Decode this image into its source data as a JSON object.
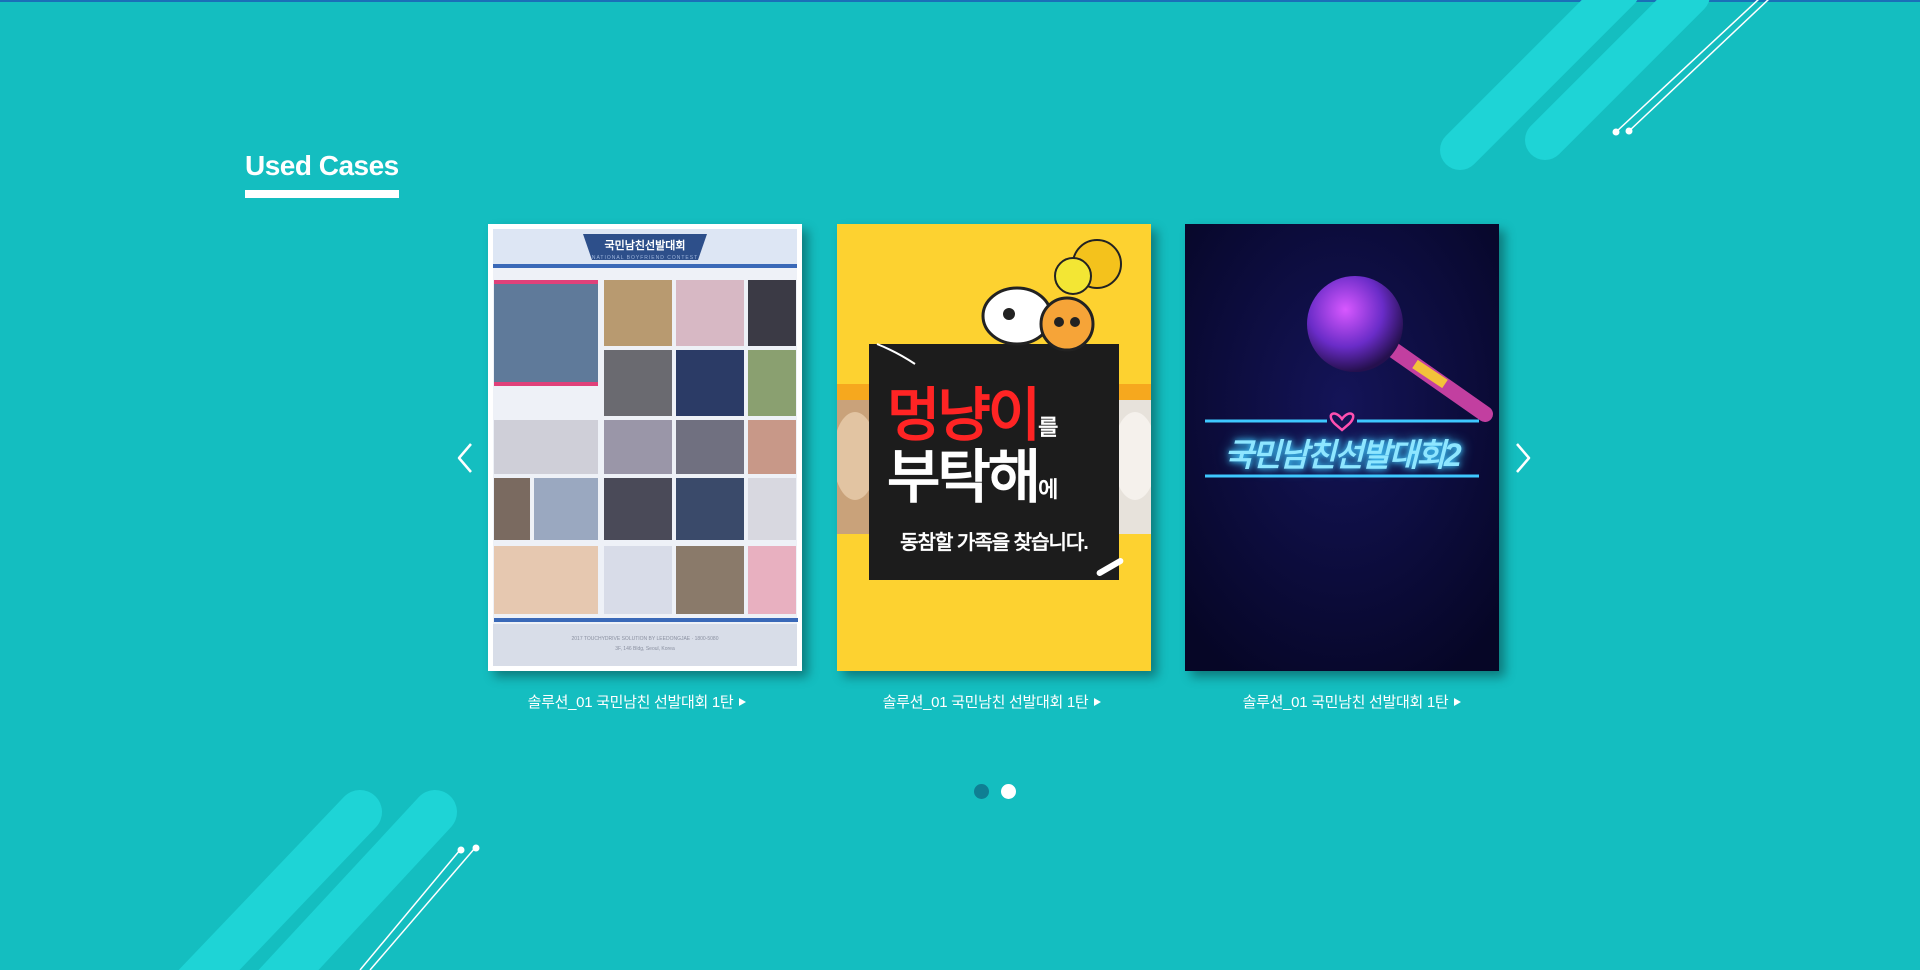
{
  "section": {
    "title": "Used Cases"
  },
  "nav": {
    "prev_icon": "chevron-left-icon",
    "next_icon": "chevron-right-icon"
  },
  "cards": [
    {
      "caption": "솔루션_01  국민남친 선발대회 1탄",
      "poster": {
        "header": "국민남친선발대회",
        "subheader": "NATIONAL BOYFRIEND CONTEST",
        "footer_line1": "2017 TOUCHYDRIVE SOLUTION BY LEEDONGJAE · 1800-5080",
        "footer_line2": "3F, 146 Bldg, Seoul, Korea"
      }
    },
    {
      "caption": "솔루션_01  국민남친 선발대회 1탄",
      "poster": {
        "line1": "멍냥이",
        "line1_suffix": "를",
        "line2": "부탁해",
        "line2_suffix": "에",
        "line3": "동참할 가족을 찾습니다."
      }
    },
    {
      "caption": "솔루션_01  국민남친 선발대회 1탄",
      "poster": {
        "neon_title": "국민남친선발대회2"
      }
    }
  ],
  "pagination": {
    "count": 2,
    "active_index": 1
  },
  "colors": {
    "background": "#14bec0",
    "deco_stripe": "#1ed4d6",
    "dot_inactive": "#0f7f93",
    "dot_active": "#ffffff",
    "poster2_bg": "#fdd230",
    "poster3_bg": "#0a0a3a",
    "neon_blue": "#3ec8ff",
    "neon_pink": "#ff4fb0"
  }
}
